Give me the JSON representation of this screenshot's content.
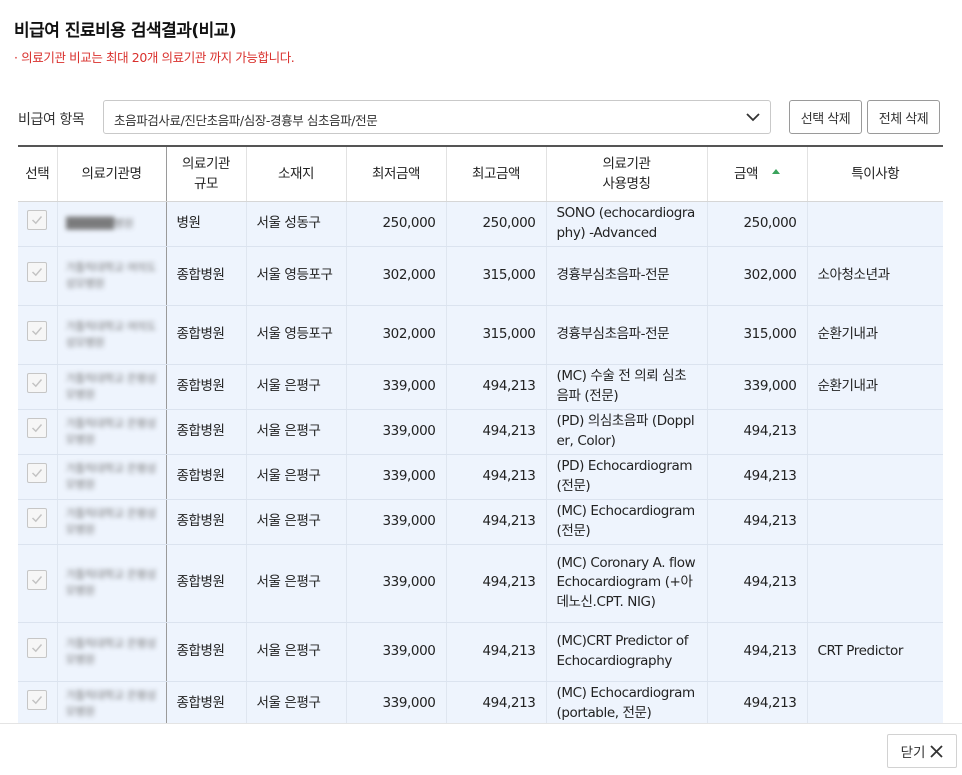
{
  "title": "비급여 진료비용 검색결과(비교)",
  "notice": "· 의료기관 비교는 최대 20개 의료기관 까지 가능합니다.",
  "filter": {
    "label": "비급여 항목",
    "selected": "초음파검사료/진단초음파/심장-경흉부 심초음파/전문"
  },
  "buttons": {
    "delete_selected": "선택 삭제",
    "delete_all": "전체 삭제",
    "close": "닫기"
  },
  "table": {
    "headers": {
      "select": "선택",
      "name": "의료기관명",
      "scale": "의료기관\n규모",
      "location": "소재지",
      "min_price": "최저금액",
      "max_price": "최고금액",
      "item_name": "의료기관\n사용명칭",
      "price": "금액",
      "note": "특이사항"
    },
    "rows": [
      {
        "name": "██████병원",
        "scale": "병원",
        "location": "서울 성동구",
        "min": "250,000",
        "max": "250,000",
        "item": "SONO (echocardiography) -Advanced",
        "price": "250,000",
        "note": ""
      },
      {
        "name": "가톨릭대학교 여의도성모병원",
        "scale": "종합병원",
        "location": "서울 영등포구",
        "min": "302,000",
        "max": "315,000",
        "item": "경흉부심초음파-전문",
        "price": "302,000",
        "note": "소아청소년과"
      },
      {
        "name": "가톨릭대학교 여의도성모병원",
        "scale": "종합병원",
        "location": "서울 영등포구",
        "min": "302,000",
        "max": "315,000",
        "item": "경흉부심초음파-전문",
        "price": "315,000",
        "note": "순환기내과"
      },
      {
        "name": "가톨릭대학교 은평성모병원",
        "scale": "종합병원",
        "location": "서울 은평구",
        "min": "339,000",
        "max": "494,213",
        "item": "(MC) 수술 전 의뢰 심초음파 (전문)",
        "price": "339,000",
        "note": "순환기내과"
      },
      {
        "name": "가톨릭대학교 은평성모병원",
        "scale": "종합병원",
        "location": "서울 은평구",
        "min": "339,000",
        "max": "494,213",
        "item": "(PD) 의심초음파 (Doppler, Color)",
        "price": "494,213",
        "note": ""
      },
      {
        "name": "가톨릭대학교 은평성모병원",
        "scale": "종합병원",
        "location": "서울 은평구",
        "min": "339,000",
        "max": "494,213",
        "item": "(PD) Echocardiogram (전문)",
        "price": "494,213",
        "note": ""
      },
      {
        "name": "가톨릭대학교 은평성모병원",
        "scale": "종합병원",
        "location": "서울 은평구",
        "min": "339,000",
        "max": "494,213",
        "item": "(MC) Echocardiogram (전문)",
        "price": "494,213",
        "note": ""
      },
      {
        "name": "가톨릭대학교 은평성모병원",
        "scale": "종합병원",
        "location": "서울 은평구",
        "min": "339,000",
        "max": "494,213",
        "item": "(MC) Coronary A. flow Echocardiogram (+아데노신.CPT. NIG)",
        "price": "494,213",
        "note": ""
      },
      {
        "name": "가톨릭대학교 은평성모병원",
        "scale": "종합병원",
        "location": "서울 은평구",
        "min": "339,000",
        "max": "494,213",
        "item": "(MC)CRT Predictor of Echocardiography",
        "price": "494,213",
        "note": "CRT Predictor"
      },
      {
        "name": "가톨릭대학교 은평성모병원",
        "scale": "종합병원",
        "location": "서울 은평구",
        "min": "339,000",
        "max": "494,213",
        "item": "(MC) Echocardiogram (portable, 전문)",
        "price": "494,213",
        "note": ""
      }
    ]
  },
  "icons": {
    "dropdown": "chevron-down-icon",
    "checkbox": "check-icon",
    "sort": "sort-asc-icon",
    "close": "close-icon"
  },
  "colors": {
    "notice": "#d9302c",
    "row_bg": "#eef4fd",
    "sort_accent": "#3aa35c"
  }
}
